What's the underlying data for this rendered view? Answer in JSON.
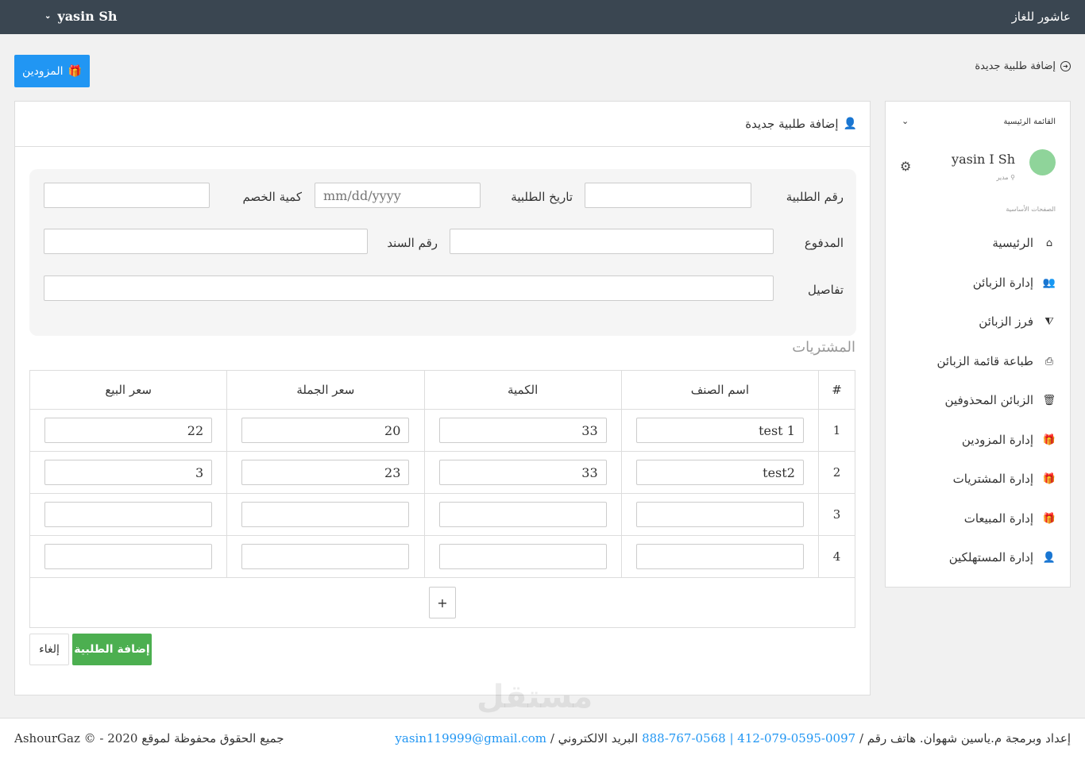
{
  "topbar": {
    "brand": "عاشور للغاز",
    "user": "yasin Sh",
    "chevron": "⌄"
  },
  "header": {
    "suppliers_button": "المزودين",
    "breadcrumb": "إضافة طلبية جديدة"
  },
  "panel": {
    "title": "إضافة طلبية جديدة"
  },
  "form": {
    "order_number_label": "رقم الطلبية",
    "order_date_label": "تاريخ الطلبية",
    "order_date_placeholder": "mm/dd/yyyy",
    "discount_label": "كمية الخصم",
    "paid_label": "المدفوع",
    "receipt_label": "رقم السند",
    "details_label": "تفاصيل"
  },
  "purchases": {
    "title": "المشتريات",
    "columns": [
      "#",
      "اسم الصنف",
      "الكمية",
      "سعر الجملة",
      "سعر البيع"
    ],
    "rows": [
      {
        "num": "1",
        "name": "test 1",
        "qty": "33",
        "wholesale": "20",
        "sale": "22"
      },
      {
        "num": "2",
        "name": "test2",
        "qty": "33",
        "wholesale": "23",
        "sale": "3"
      },
      {
        "num": "3",
        "name": "",
        "qty": "",
        "wholesale": "",
        "sale": ""
      },
      {
        "num": "4",
        "name": "",
        "qty": "",
        "wholesale": "",
        "sale": ""
      }
    ],
    "add_row": "+"
  },
  "actions": {
    "submit": "إضافة الطلبية",
    "cancel": "إلغاء"
  },
  "sidebar": {
    "title": "القائمة الرئيسية",
    "user_name": "yasin I Sh",
    "user_role": "مدير",
    "section": "الصفحات الأساسية",
    "items": [
      {
        "label": "الرئيسية",
        "icon": "home-icon",
        "glyph": "⌂"
      },
      {
        "label": "إدارة الزبائن",
        "icon": "users-icon",
        "glyph": "👥"
      },
      {
        "label": "فرز الزبائن",
        "icon": "filter-icon",
        "glyph": "⧩"
      },
      {
        "label": "طباعة قائمة الزبائن",
        "icon": "print-icon",
        "glyph": "⎙"
      },
      {
        "label": "الزبائن المحذوفين",
        "icon": "trash-icon",
        "glyph": "🗑"
      },
      {
        "label": "إدارة المزودين",
        "icon": "gift-icon",
        "glyph": "🎁"
      },
      {
        "label": "إدارة المشتريات",
        "icon": "gift-icon",
        "glyph": "🎁"
      },
      {
        "label": "إدارة المبيعات",
        "icon": "gift-icon",
        "glyph": "🎁"
      },
      {
        "label": "إدارة المستهلكين",
        "icon": "user-icon",
        "glyph": "👤"
      }
    ]
  },
  "footer": {
    "copyright": "جميع الحقوق محفوظة لموقع 2020 - © AshourGaz",
    "credits_prefix": "إعداد وبرمجة م.ياسين شهوان. هاتف رقم /",
    "phones": "0097-0595-079-412 | 0568-767-888",
    "email_label": "البريد الالكتروني /",
    "email": "yasin119999@gmail.com"
  },
  "watermark": "مستقل"
}
